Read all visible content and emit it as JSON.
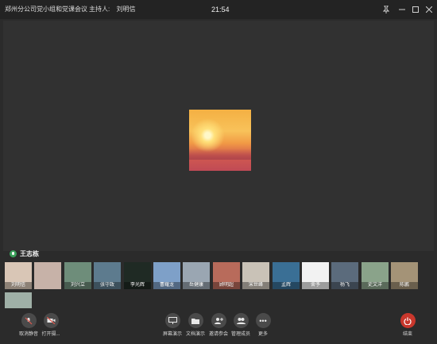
{
  "window": {
    "title": "郑州分公司党小组和党课会议",
    "host_label": "主持人:",
    "host_name": "刘明信",
    "clock": "21:54",
    "pin_icon": "pin-icon",
    "minimize_icon": "minimize-icon",
    "maximize_icon": "maximize-icon",
    "close_icon": "close-icon"
  },
  "speaker": {
    "name": "王志栋",
    "mic_icon": "microphone-icon"
  },
  "participants": [
    {
      "name": "刘明信",
      "color": "#d9c6b6"
    },
    {
      "name": "",
      "color": "#c7b2a8"
    },
    {
      "name": "刘兴立",
      "color": "#6e8d7a"
    },
    {
      "name": "张守政",
      "color": "#5d7b8e"
    },
    {
      "name": "李光辉",
      "color": "#1f2a24"
    },
    {
      "name": "曹耀龙",
      "color": "#7ea0c8"
    },
    {
      "name": "岳健康",
      "color": "#9aa6b2"
    },
    {
      "name": "顾明超",
      "color": "#b86b5b"
    },
    {
      "name": "宋世峰",
      "color": "#c9c2b7"
    },
    {
      "name": "孟辉",
      "color": "#3a6f95"
    },
    {
      "name": "舍予",
      "color": "#f2f2f2"
    },
    {
      "name": "杨飞",
      "color": "#5b6b7c"
    },
    {
      "name": "史文洋",
      "color": "#8aa38a"
    },
    {
      "name": "陈鹏",
      "color": "#a49377"
    },
    {
      "name": "",
      "color": "#9fb0a7"
    }
  ],
  "controls": {
    "mute": "取消静音",
    "camera": "打开摄...",
    "share_screen": "屏幕演示",
    "share_doc": "文档演示",
    "invite": "邀请参会",
    "manage": "管理成员",
    "more": "更多",
    "end": "结束"
  }
}
